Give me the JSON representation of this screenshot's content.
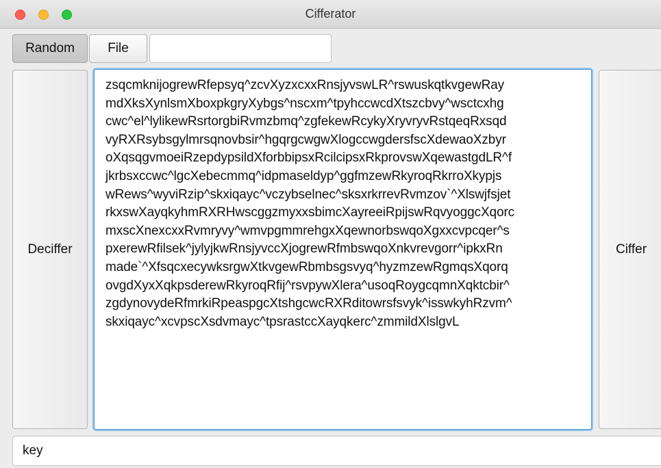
{
  "window": {
    "title": "Cifferator"
  },
  "toolbar": {
    "random_label": "Random",
    "file_label": "File",
    "file_path_value": ""
  },
  "side_buttons": {
    "decipher_label": "Deciffer",
    "cipher_label": "Ciffer"
  },
  "editor": {
    "lines": [
      "zsqcmknijogrewRfepsyq^zcvXyzxcxxRnsjyvswLR^rswuskqtkvgewRay",
      "mdXksXynlsmXboxpkgryXybgs^nscxm^tpyhccwcdXtszcbvy^wsctcxhg",
      "cwc^el^lylikewRsrtorgbiRvmzbmq^zgfekewRcykyXryvryvRstqeqRxsqd",
      "vyRXRsybsgylmrsqnovbsir^hgqrgcwgwXlogccwgdersfscXdewaoXzbyr",
      "oXqsqgvmoeiRzepdypsildXforbbipsxRcilcipsxRkprovswXqewastgdLR^f",
      "jkrbsxccwc^lgcXebecmmq^idpmaseldyp^ggfmzewRkyroqRkrroXkypjs",
      "wRews^wyviRzip^skxiqayc^vczybselnec^sksxrkrrevRvmzov`^Xlswjfsjet",
      "rkxswXayqkyhmRXRHwscggzmyxxsbimcXayreeiRpijswRqvyoggcXqorc",
      "mxscXnexcxxRvmryvy^wmvpgmmrehgxXqewnorbswqoXgxxcvpcqer^s",
      "pxerewRfilsek^jylyjkwRnsjyvccXjogrewRfmbswqoXnkvrevgorr^ipkxRn",
      "made`^XfsqcxecywksrgwXtkvgewRbmbsgsvyq^hyzmzewRgmqsXqorq",
      "ovgdXyxXqkpsderewRkyroqRfij^rsvpywXlera^usoqRoygcqmnXqktcbir^",
      "zgdynovydeRfmrkiRpeaspgcXtshgcwcRXRditowrsfsvyk^isswkyhRzvm^",
      "skxiqayc^xcvpscXsdvmayc^tpsrastccXayqkerc^zmmildXlslgvL"
    ]
  },
  "key_field": {
    "value": "key"
  },
  "colors": {
    "focus_ring": "#4a96d3",
    "close": "#fd5f57",
    "minimize": "#febc2e",
    "maximize": "#28c840"
  }
}
